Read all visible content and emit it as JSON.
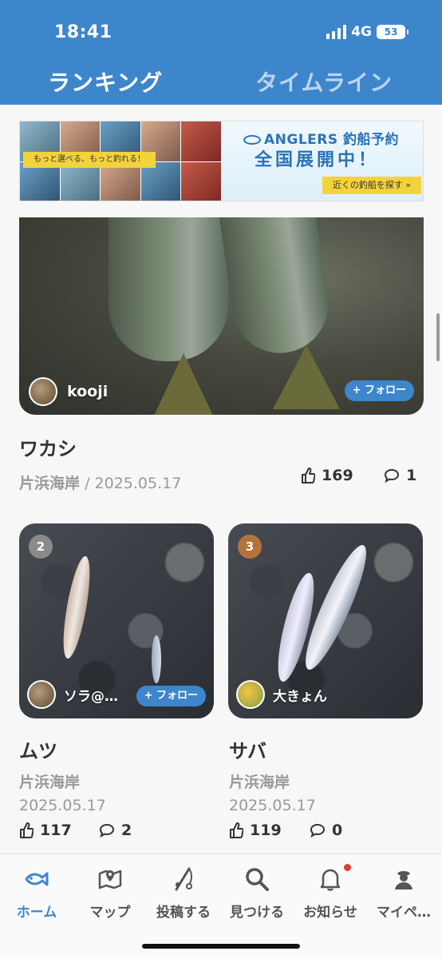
{
  "status_bar": {
    "time": "18:41",
    "network": "4G",
    "battery": "53"
  },
  "tabs": {
    "active": "ランキング",
    "inactive": "タイムライン"
  },
  "banner": {
    "tagline": "もっと選べる、もっと釣れる！",
    "logo": "ANGLERS 釣船予約",
    "headline": "全国展開中！",
    "cta": "近くの釣船を探す »"
  },
  "featured": {
    "user": "kooji",
    "follow": "+ フォロー",
    "fish": "ワカシ",
    "spot": "片浜海岸",
    "separator": "/",
    "date": "2025.05.17",
    "likes": "169",
    "comments": "1"
  },
  "cards": [
    {
      "rank": "2",
      "user": "ソラ@…",
      "follow": "+ フォロー",
      "fish": "ムツ",
      "spot": "片浜海岸",
      "date": "2025.05.17",
      "likes": "117",
      "comments": "2"
    },
    {
      "rank": "3",
      "user": "大きょん",
      "fish": "サバ",
      "spot": "片浜海岸",
      "date": "2025.05.17",
      "likes": "119",
      "comments": "0"
    }
  ],
  "tabbar": {
    "home": "ホーム",
    "map": "マップ",
    "post": "投稿する",
    "find": "見つける",
    "notifications": "お知らせ",
    "mypage": "マイペ…"
  },
  "colors": {
    "accent": "#3d86cc",
    "rank2": "#8a8a8a",
    "rank3": "#b5733c",
    "badge": "#e53935"
  }
}
